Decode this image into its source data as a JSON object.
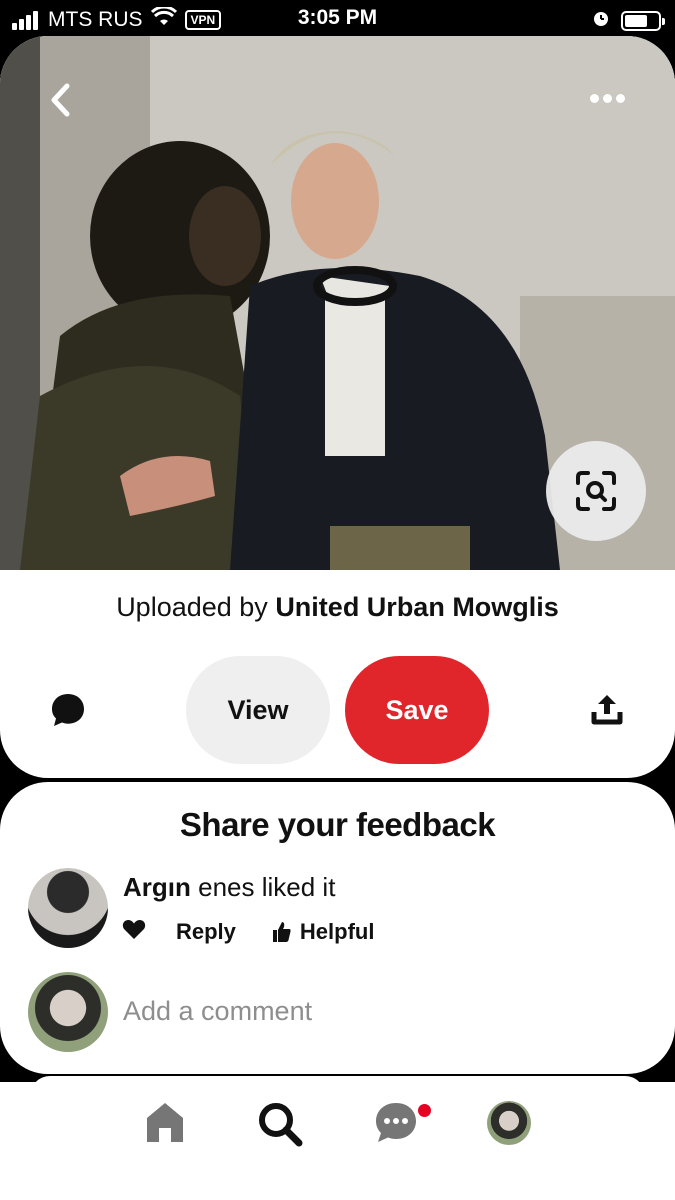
{
  "status_bar": {
    "carrier": "MTS RUS",
    "vpn": "VPN",
    "time": "3:05 PM"
  },
  "pin": {
    "uploaded_prefix": "Uploaded by ",
    "uploader": "United Urban Mowglis",
    "view_label": "View",
    "save_label": "Save",
    "save_color": "#e0252b"
  },
  "feedback": {
    "title": "Share your feedback",
    "comment": {
      "user": "Argın",
      "text": " enes liked it",
      "reply_label": "Reply",
      "helpful_label": "Helpful"
    },
    "add_comment_placeholder": "Add a comment"
  },
  "nav": {
    "items": [
      "home-icon",
      "search-icon",
      "messages-icon",
      "profile-avatar"
    ],
    "notification_color": "#e60023"
  }
}
